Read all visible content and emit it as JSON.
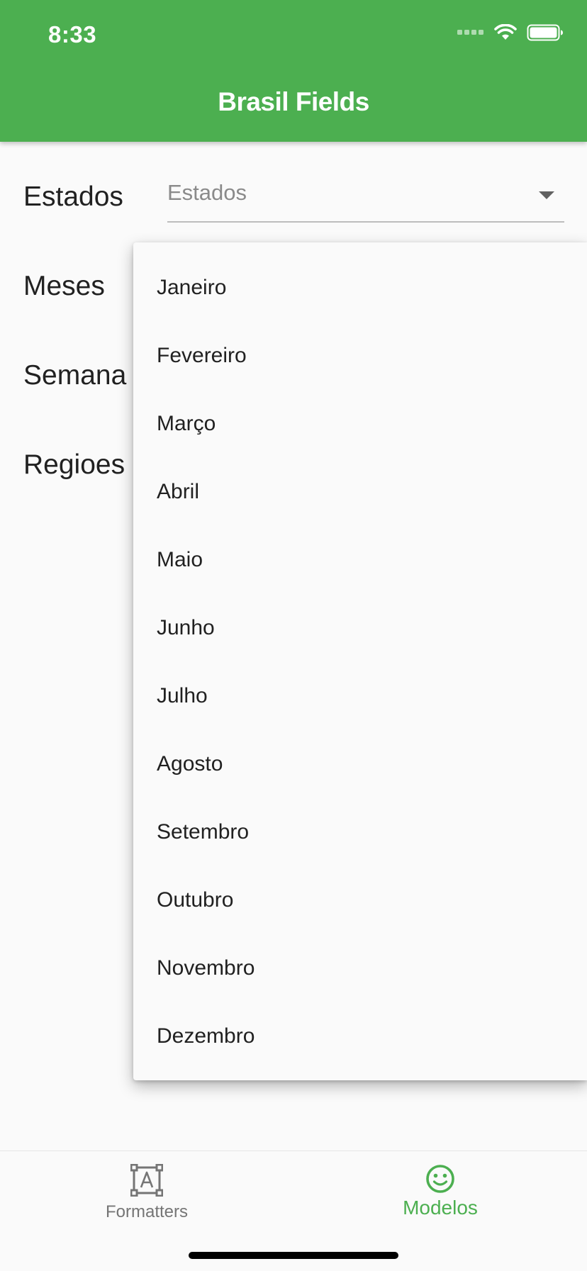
{
  "status_bar": {
    "time": "8:33",
    "icons": [
      "signal-icon",
      "wifi-icon",
      "battery-icon"
    ]
  },
  "app_bar": {
    "title": "Brasil Fields",
    "color": "#4caf50"
  },
  "form": {
    "rows": [
      {
        "label": "Estados",
        "value": "Estados"
      },
      {
        "label": "Meses"
      },
      {
        "label": "Semana"
      },
      {
        "label": "Regioes"
      }
    ]
  },
  "menu": {
    "items": [
      "Janeiro",
      "Fevereiro",
      "Março",
      "Abril",
      "Maio",
      "Junho",
      "Julho",
      "Agosto",
      "Setembro",
      "Outubro",
      "Novembro",
      "Dezembro"
    ]
  },
  "bottom_nav": {
    "items": [
      {
        "label": "Formatters",
        "icon": "text-format-icon",
        "active": false
      },
      {
        "label": "Modelos",
        "icon": "smiley-icon",
        "active": true
      }
    ],
    "active_color": "#4caf50",
    "inactive_color": "#757575"
  }
}
